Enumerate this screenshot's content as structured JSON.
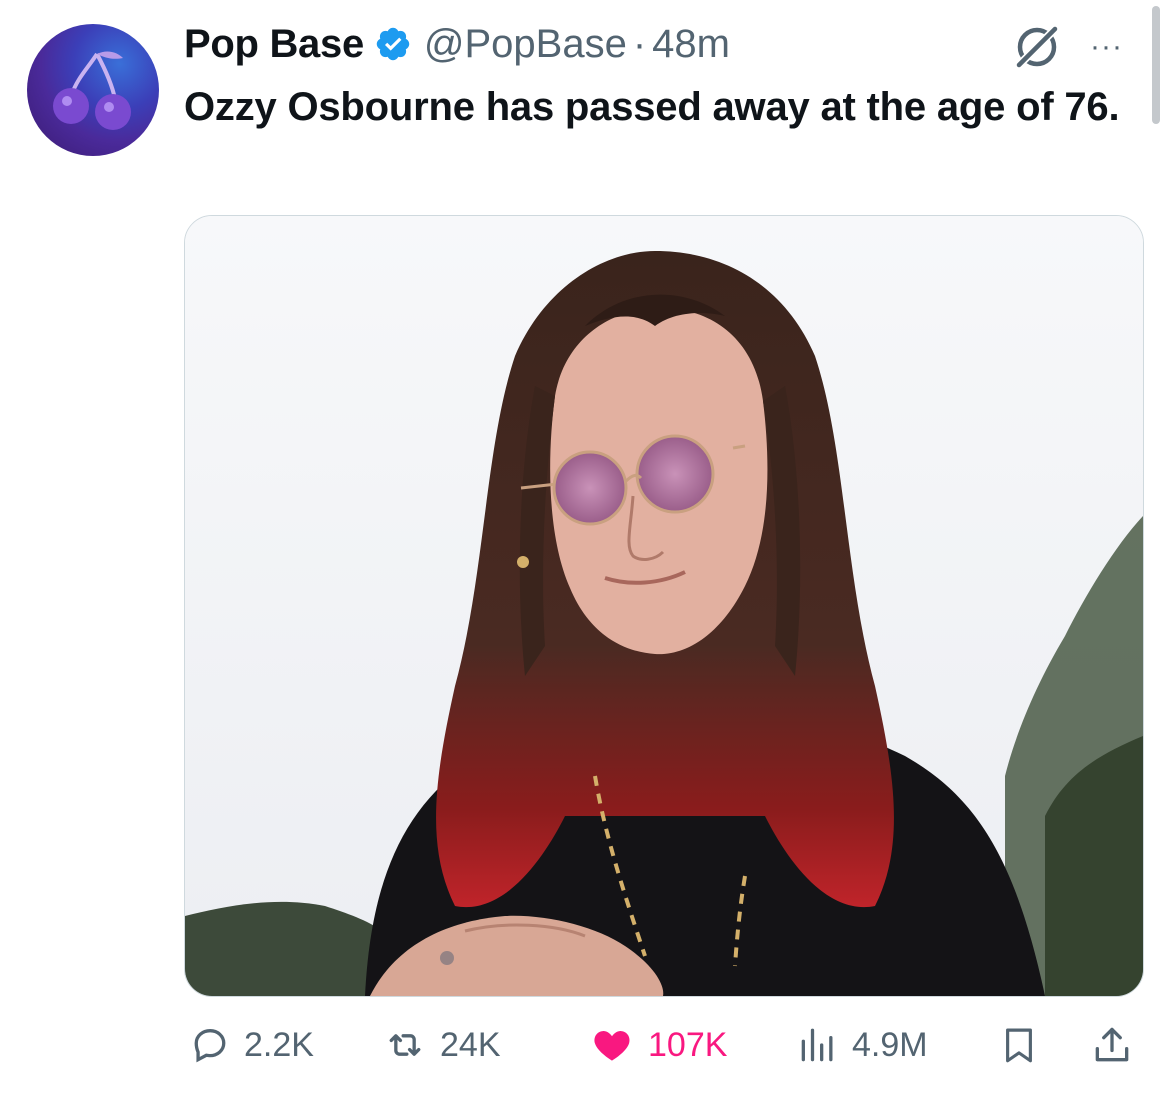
{
  "author": {
    "name": "Pop Base",
    "handle": "@PopBase",
    "separator": "·",
    "time": "48m",
    "avatar_icon": "cherries-icon",
    "verified_color": "#1d9bf0"
  },
  "tweet": {
    "text": "Ozzy Osbourne has passed away at the age of 76."
  },
  "icons": {
    "grok": "grok-icon",
    "more": "···"
  },
  "actions": {
    "replies": "2.2K",
    "reposts": "24K",
    "likes": "107K",
    "views": "4.9M"
  },
  "colors": {
    "like_active": "#f91880",
    "secondary_text": "#536471",
    "primary_text": "#0f1419"
  }
}
